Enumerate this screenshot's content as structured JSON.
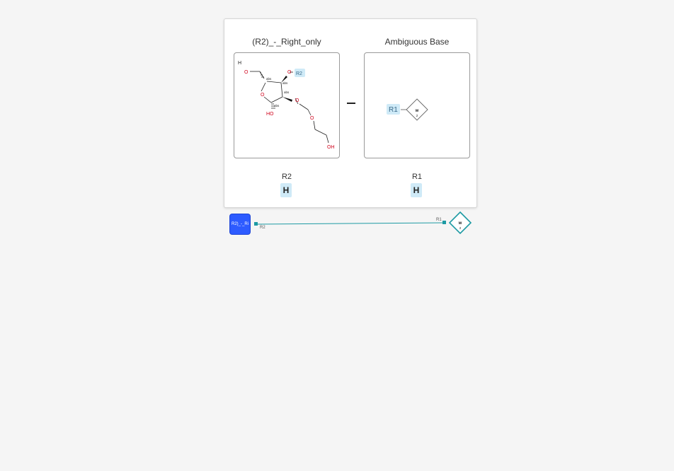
{
  "tooltip": {
    "left_title": "(R2)_-_Right_only",
    "right_title": "Ambiguous Base",
    "left_rgroup_name": "R2",
    "left_rgroup_value": "H",
    "right_rgroup_name": "R1",
    "right_rgroup_value": "H",
    "separator": "–"
  },
  "structure": {
    "H": "H",
    "O_top_left": "O",
    "O_right": "O",
    "R2_tag": "R2",
    "O_ring": "O",
    "HO": "HO",
    "O_mid": "O",
    "O_chain": "O",
    "OH": "OH",
    "abs_labels": [
      "abs",
      "abs",
      "abs",
      "abs"
    ]
  },
  "ambiguous_base": {
    "r1_tag": "R1",
    "symbol": "w",
    "count": "2"
  },
  "canvas": {
    "sugar_label": "R2)_-_Ri",
    "port_r2": "R2",
    "port_r1": "R1",
    "base_symbol": "w",
    "base_count": "2"
  },
  "colors": {
    "sugar_node": "#2d5bff",
    "bond_line": "#1d9aa3",
    "heteroatom": "#d0021b",
    "rgroup_chip": "#cfeaf7"
  }
}
